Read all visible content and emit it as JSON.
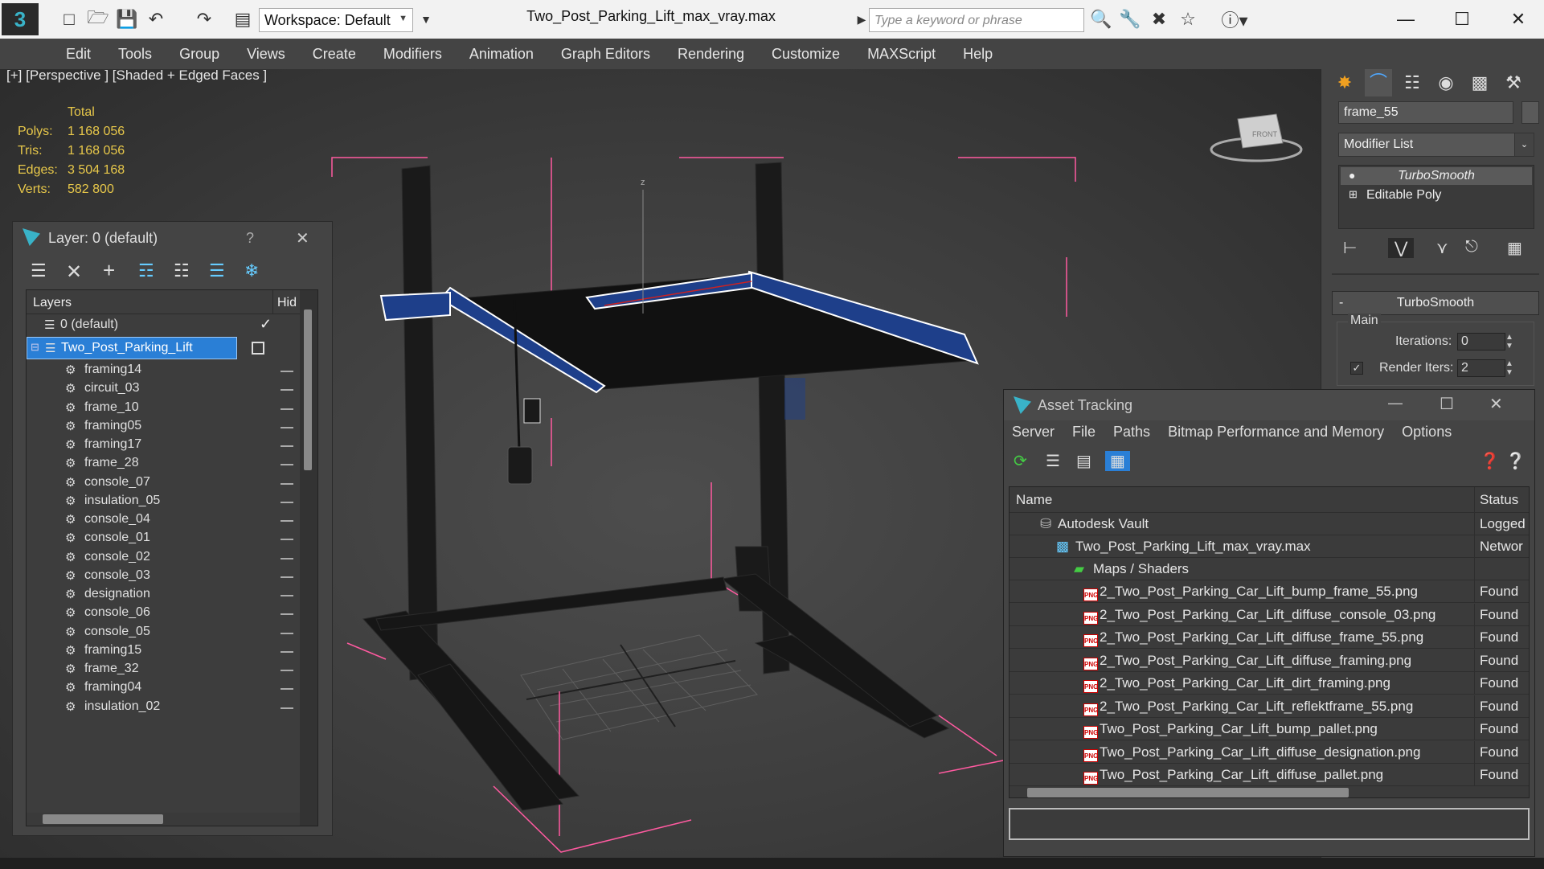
{
  "app": {
    "doc_title": "Two_Post_Parking_Lift_max_vray.max",
    "workspace_label": "Workspace: Default",
    "search_placeholder": "Type a keyword or phrase"
  },
  "menu": [
    "Edit",
    "Tools",
    "Group",
    "Views",
    "Create",
    "Modifiers",
    "Animation",
    "Graph Editors",
    "Rendering",
    "Customize",
    "MAXScript",
    "Help"
  ],
  "viewport": {
    "label": "[+] [Perspective ] [Shaded + Edged Faces ]",
    "stats_header": "Total",
    "stats": [
      {
        "k": "Polys:",
        "v": "1 168 056"
      },
      {
        "k": "Tris:",
        "v": "1 168 056"
      },
      {
        "k": "Edges:",
        "v": "3 504 168"
      },
      {
        "k": "Verts:",
        "v": "582 800"
      }
    ],
    "gizmo_axis": "z",
    "viewcube_face": "FRONT"
  },
  "command_panel": {
    "object_name": "frame_55",
    "modifier_list": "Modifier List",
    "stack": [
      "TurboSmooth",
      "Editable Poly"
    ],
    "rollout_title": "TurboSmooth",
    "rollout_collapse": "-",
    "group_main": "Main",
    "iterations_label": "Iterations:",
    "iterations_value": "0",
    "render_iters_label": "Render Iters:",
    "render_iters_value": "2",
    "render_iters_checked": true
  },
  "layer_dialog": {
    "title": "Layer: 0 (default)",
    "help": "?",
    "col_layers": "Layers",
    "col_hide": "Hid",
    "default_layer": "0 (default)",
    "selected_layer": "Two_Post_Parking_Lift",
    "objects": [
      "framing14",
      "circuit_03",
      "frame_10",
      "framing05",
      "framing17",
      "frame_28",
      "console_07",
      "insulation_05",
      "console_04",
      "console_01",
      "console_02",
      "console_03",
      "designation",
      "console_06",
      "console_05",
      "framing15",
      "frame_32",
      "framing04",
      "insulation_02"
    ]
  },
  "asset_dialog": {
    "title": "Asset Tracking",
    "menu": [
      "Server",
      "File",
      "Paths",
      "Bitmap Performance and Memory",
      "Options"
    ],
    "col_name": "Name",
    "col_status": "Status",
    "vault": {
      "name": "Autodesk Vault",
      "status": "Logged"
    },
    "file": {
      "name": "Two_Post_Parking_Lift_max_vray.max",
      "status": "Networ"
    },
    "group": "Maps / Shaders",
    "maps": [
      {
        "name": "2_Two_Post_Parking_Car_Lift_bump_frame_55.png",
        "status": "Found"
      },
      {
        "name": "2_Two_Post_Parking_Car_Lift_diffuse_console_03.png",
        "status": "Found"
      },
      {
        "name": "2_Two_Post_Parking_Car_Lift_diffuse_frame_55.png",
        "status": "Found"
      },
      {
        "name": "2_Two_Post_Parking_Car_Lift_diffuse_framing.png",
        "status": "Found"
      },
      {
        "name": "2_Two_Post_Parking_Car_Lift_dirt_framing.png",
        "status": "Found"
      },
      {
        "name": "2_Two_Post_Parking_Car_Lift_reflektframe_55.png",
        "status": "Found"
      },
      {
        "name": "Two_Post_Parking_Car_Lift_bump_pallet.png",
        "status": "Found"
      },
      {
        "name": "Two_Post_Parking_Car_Lift_diffuse_designation.png",
        "status": "Found"
      },
      {
        "name": "Two_Post_Parking_Car_Lift_diffuse_pallet.png",
        "status": "Found"
      }
    ]
  },
  "colors": {
    "selection_blue": "#2a7fd6",
    "stats_yellow": "#e8c84a",
    "bbox_pink": "#ff5aa0",
    "wire_blue": "#1e3f8a"
  }
}
